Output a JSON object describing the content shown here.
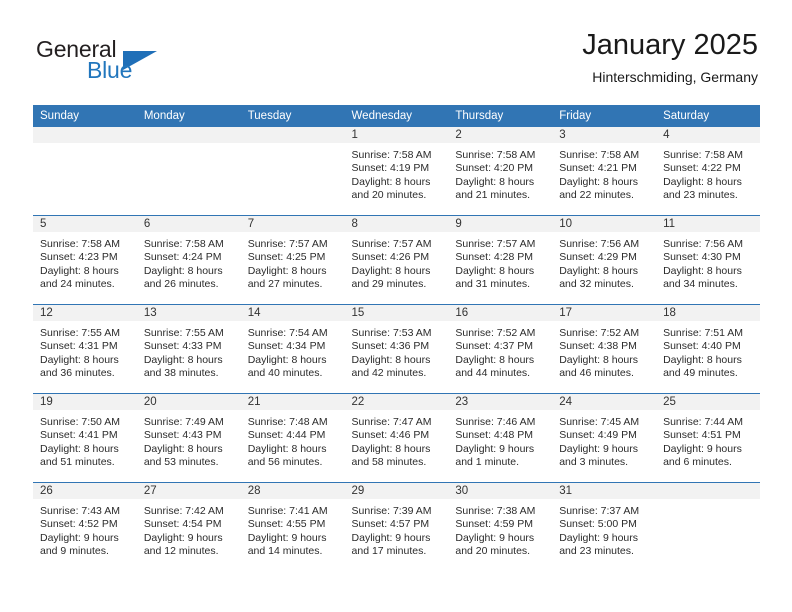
{
  "brand": {
    "name_top": "General",
    "name_bottom": "Blue",
    "accent_color": "#2176bd",
    "triangle_color": "#1f6fb8"
  },
  "header": {
    "title": "January 2025",
    "location": "Hinterschmiding, Germany"
  },
  "theme": {
    "header_band_color": "#3175b4",
    "daynum_band_color": "#f2f2f2",
    "grid_line_color": "#3175b4",
    "text_color": "#2b2b2b"
  },
  "weekday_headers": [
    "Sunday",
    "Monday",
    "Tuesday",
    "Wednesday",
    "Thursday",
    "Friday",
    "Saturday"
  ],
  "labels": {
    "sunrise_prefix": "Sunrise:",
    "sunset_prefix": "Sunset:",
    "daylight_prefix": "Daylight:"
  },
  "weeks": [
    [
      {
        "day": "",
        "empty": true
      },
      {
        "day": "",
        "empty": true
      },
      {
        "day": "",
        "empty": true
      },
      {
        "day": "1",
        "sunrise": "Sunrise: 7:58 AM",
        "sunset": "Sunset: 4:19 PM",
        "daylight_l1": "Daylight: 8 hours",
        "daylight_l2": "and 20 minutes."
      },
      {
        "day": "2",
        "sunrise": "Sunrise: 7:58 AM",
        "sunset": "Sunset: 4:20 PM",
        "daylight_l1": "Daylight: 8 hours",
        "daylight_l2": "and 21 minutes."
      },
      {
        "day": "3",
        "sunrise": "Sunrise: 7:58 AM",
        "sunset": "Sunset: 4:21 PM",
        "daylight_l1": "Daylight: 8 hours",
        "daylight_l2": "and 22 minutes."
      },
      {
        "day": "4",
        "sunrise": "Sunrise: 7:58 AM",
        "sunset": "Sunset: 4:22 PM",
        "daylight_l1": "Daylight: 8 hours",
        "daylight_l2": "and 23 minutes."
      }
    ],
    [
      {
        "day": "5",
        "sunrise": "Sunrise: 7:58 AM",
        "sunset": "Sunset: 4:23 PM",
        "daylight_l1": "Daylight: 8 hours",
        "daylight_l2": "and 24 minutes."
      },
      {
        "day": "6",
        "sunrise": "Sunrise: 7:58 AM",
        "sunset": "Sunset: 4:24 PM",
        "daylight_l1": "Daylight: 8 hours",
        "daylight_l2": "and 26 minutes."
      },
      {
        "day": "7",
        "sunrise": "Sunrise: 7:57 AM",
        "sunset": "Sunset: 4:25 PM",
        "daylight_l1": "Daylight: 8 hours",
        "daylight_l2": "and 27 minutes."
      },
      {
        "day": "8",
        "sunrise": "Sunrise: 7:57 AM",
        "sunset": "Sunset: 4:26 PM",
        "daylight_l1": "Daylight: 8 hours",
        "daylight_l2": "and 29 minutes."
      },
      {
        "day": "9",
        "sunrise": "Sunrise: 7:57 AM",
        "sunset": "Sunset: 4:28 PM",
        "daylight_l1": "Daylight: 8 hours",
        "daylight_l2": "and 31 minutes."
      },
      {
        "day": "10",
        "sunrise": "Sunrise: 7:56 AM",
        "sunset": "Sunset: 4:29 PM",
        "daylight_l1": "Daylight: 8 hours",
        "daylight_l2": "and 32 minutes."
      },
      {
        "day": "11",
        "sunrise": "Sunrise: 7:56 AM",
        "sunset": "Sunset: 4:30 PM",
        "daylight_l1": "Daylight: 8 hours",
        "daylight_l2": "and 34 minutes."
      }
    ],
    [
      {
        "day": "12",
        "sunrise": "Sunrise: 7:55 AM",
        "sunset": "Sunset: 4:31 PM",
        "daylight_l1": "Daylight: 8 hours",
        "daylight_l2": "and 36 minutes."
      },
      {
        "day": "13",
        "sunrise": "Sunrise: 7:55 AM",
        "sunset": "Sunset: 4:33 PM",
        "daylight_l1": "Daylight: 8 hours",
        "daylight_l2": "and 38 minutes."
      },
      {
        "day": "14",
        "sunrise": "Sunrise: 7:54 AM",
        "sunset": "Sunset: 4:34 PM",
        "daylight_l1": "Daylight: 8 hours",
        "daylight_l2": "and 40 minutes."
      },
      {
        "day": "15",
        "sunrise": "Sunrise: 7:53 AM",
        "sunset": "Sunset: 4:36 PM",
        "daylight_l1": "Daylight: 8 hours",
        "daylight_l2": "and 42 minutes."
      },
      {
        "day": "16",
        "sunrise": "Sunrise: 7:52 AM",
        "sunset": "Sunset: 4:37 PM",
        "daylight_l1": "Daylight: 8 hours",
        "daylight_l2": "and 44 minutes."
      },
      {
        "day": "17",
        "sunrise": "Sunrise: 7:52 AM",
        "sunset": "Sunset: 4:38 PM",
        "daylight_l1": "Daylight: 8 hours",
        "daylight_l2": "and 46 minutes."
      },
      {
        "day": "18",
        "sunrise": "Sunrise: 7:51 AM",
        "sunset": "Sunset: 4:40 PM",
        "daylight_l1": "Daylight: 8 hours",
        "daylight_l2": "and 49 minutes."
      }
    ],
    [
      {
        "day": "19",
        "sunrise": "Sunrise: 7:50 AM",
        "sunset": "Sunset: 4:41 PM",
        "daylight_l1": "Daylight: 8 hours",
        "daylight_l2": "and 51 minutes."
      },
      {
        "day": "20",
        "sunrise": "Sunrise: 7:49 AM",
        "sunset": "Sunset: 4:43 PM",
        "daylight_l1": "Daylight: 8 hours",
        "daylight_l2": "and 53 minutes."
      },
      {
        "day": "21",
        "sunrise": "Sunrise: 7:48 AM",
        "sunset": "Sunset: 4:44 PM",
        "daylight_l1": "Daylight: 8 hours",
        "daylight_l2": "and 56 minutes."
      },
      {
        "day": "22",
        "sunrise": "Sunrise: 7:47 AM",
        "sunset": "Sunset: 4:46 PM",
        "daylight_l1": "Daylight: 8 hours",
        "daylight_l2": "and 58 minutes."
      },
      {
        "day": "23",
        "sunrise": "Sunrise: 7:46 AM",
        "sunset": "Sunset: 4:48 PM",
        "daylight_l1": "Daylight: 9 hours",
        "daylight_l2": "and 1 minute."
      },
      {
        "day": "24",
        "sunrise": "Sunrise: 7:45 AM",
        "sunset": "Sunset: 4:49 PM",
        "daylight_l1": "Daylight: 9 hours",
        "daylight_l2": "and 3 minutes."
      },
      {
        "day": "25",
        "sunrise": "Sunrise: 7:44 AM",
        "sunset": "Sunset: 4:51 PM",
        "daylight_l1": "Daylight: 9 hours",
        "daylight_l2": "and 6 minutes."
      }
    ],
    [
      {
        "day": "26",
        "sunrise": "Sunrise: 7:43 AM",
        "sunset": "Sunset: 4:52 PM",
        "daylight_l1": "Daylight: 9 hours",
        "daylight_l2": "and 9 minutes."
      },
      {
        "day": "27",
        "sunrise": "Sunrise: 7:42 AM",
        "sunset": "Sunset: 4:54 PM",
        "daylight_l1": "Daylight: 9 hours",
        "daylight_l2": "and 12 minutes."
      },
      {
        "day": "28",
        "sunrise": "Sunrise: 7:41 AM",
        "sunset": "Sunset: 4:55 PM",
        "daylight_l1": "Daylight: 9 hours",
        "daylight_l2": "and 14 minutes."
      },
      {
        "day": "29",
        "sunrise": "Sunrise: 7:39 AM",
        "sunset": "Sunset: 4:57 PM",
        "daylight_l1": "Daylight: 9 hours",
        "daylight_l2": "and 17 minutes."
      },
      {
        "day": "30",
        "sunrise": "Sunrise: 7:38 AM",
        "sunset": "Sunset: 4:59 PM",
        "daylight_l1": "Daylight: 9 hours",
        "daylight_l2": "and 20 minutes."
      },
      {
        "day": "31",
        "sunrise": "Sunrise: 7:37 AM",
        "sunset": "Sunset: 5:00 PM",
        "daylight_l1": "Daylight: 9 hours",
        "daylight_l2": "and 23 minutes."
      },
      {
        "day": "",
        "empty": true
      }
    ]
  ]
}
